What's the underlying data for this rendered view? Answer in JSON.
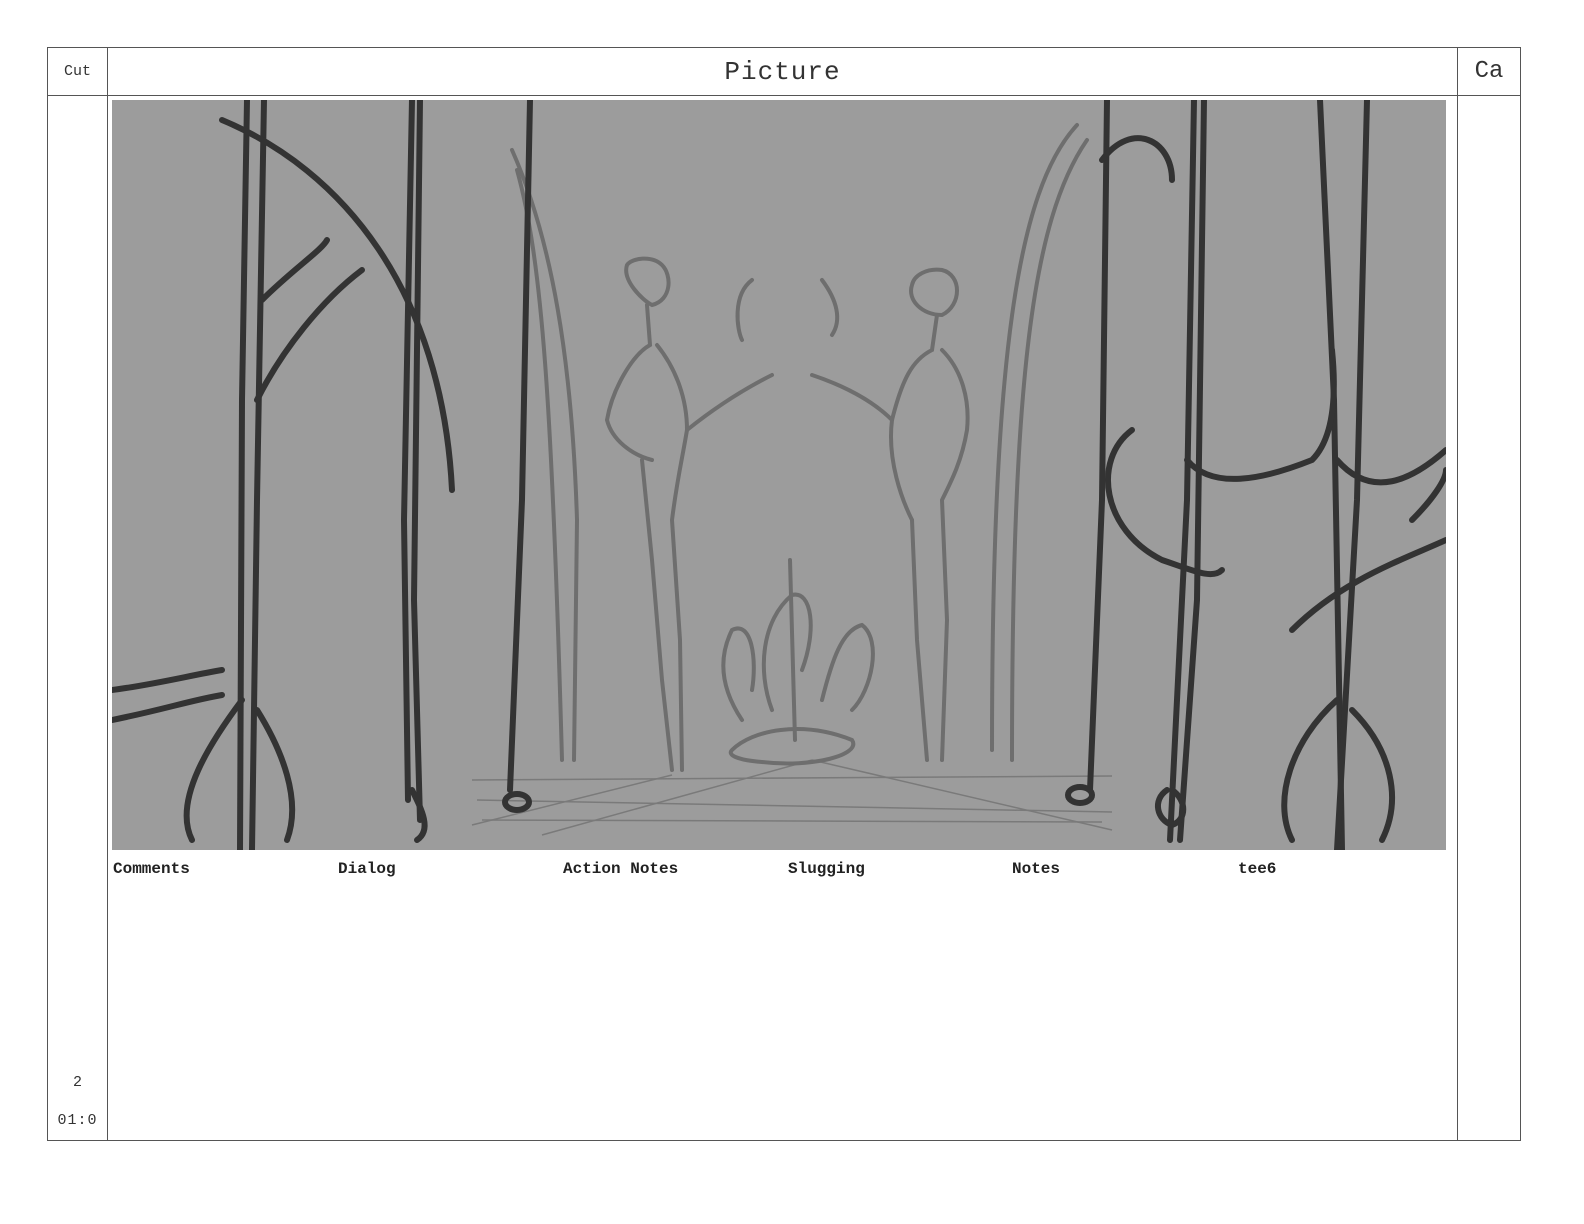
{
  "header": {
    "cut_label": "Cut",
    "picture_label": "Picture",
    "camera_label": "Ca"
  },
  "panel": {
    "background_color": "#9c9c9c",
    "sketch_dark_color": "#333333",
    "sketch_light_color": "#6e6e6e"
  },
  "fields": [
    "Comments",
    "Dialog",
    "Action Notes",
    "Slugging",
    "Notes",
    "tee6"
  ],
  "cut": {
    "number": "2",
    "duration": "01:0"
  }
}
